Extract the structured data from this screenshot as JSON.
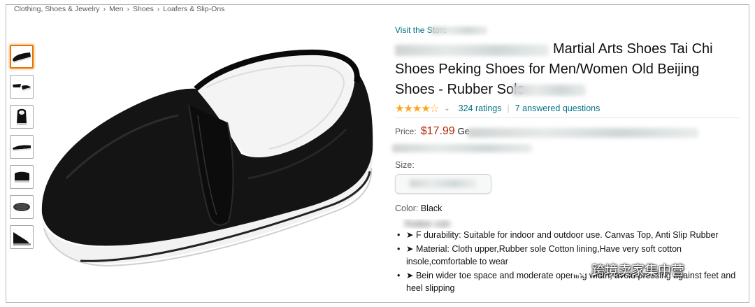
{
  "breadcrumb": [
    "Clothing, Shoes & Jewelry",
    "Men",
    "Shoes",
    "Loafers & Slip-Ons"
  ],
  "product": {
    "visit_store": "Visit the Store",
    "title_line1": "Martial Arts Shoes Tai Chi",
    "title_line2": "Shoes Peking Shoes for Men/Women Old Beijing",
    "title_line3": "Shoes - Rubber Sole",
    "stars": "★★★★☆",
    "ratings": "324 ratings",
    "answered": "7 answered questions",
    "price_label": "Price:",
    "price": "$17.99",
    "price_suffix": "Ge",
    "size_label": "Size:",
    "color_label": "Color:",
    "color_value": "Black",
    "rubber_sole": "Rubber sole",
    "bullets": [
      "➤ F durability: Suitable for indoor and outdoor use. Canvas Top, Anti Slip Rubber",
      "➤ Material: Cloth upper,Rubber sole Cotton lining,Have very soft cotton insole,comfortable to wear",
      "➤ Bein wider toe space and moderate opening width, avoid pressing against feet and heel slipping"
    ]
  },
  "watermark": "跨境卖家集中营",
  "colors": {
    "link": "#007185",
    "price": "#b12704",
    "star": "#ffa41c",
    "selected_thumb": "#e77600"
  },
  "thumbnails": [
    "thumb-shoe-side",
    "thumb-shoe-pair",
    "thumb-shoe-front",
    "thumb-shoe-angle",
    "thumb-shoe-back",
    "thumb-sole",
    "thumb-shoe-dark"
  ]
}
